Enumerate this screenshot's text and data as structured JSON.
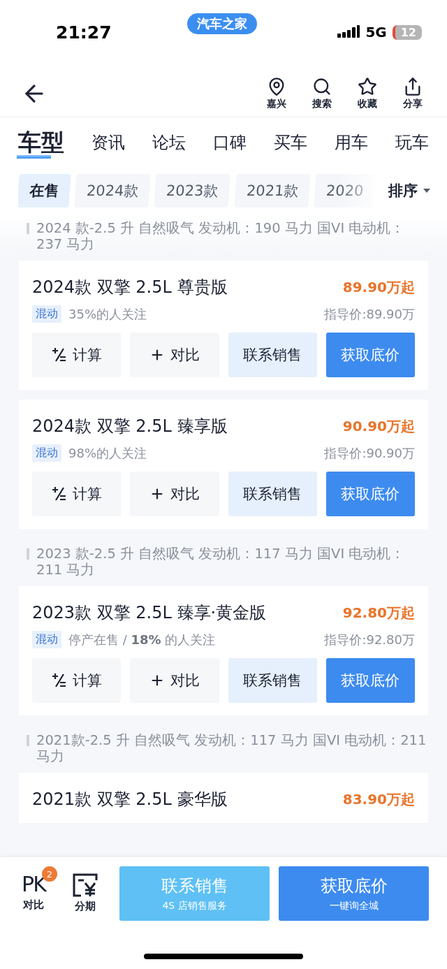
{
  "status_bar": {
    "time": "21:27",
    "app_pill": "汽车之家",
    "network": "5G",
    "battery": "12"
  },
  "header": {
    "actions": [
      {
        "kind": "location",
        "label": "嘉兴"
      },
      {
        "kind": "search",
        "label": "搜索"
      },
      {
        "kind": "favorite",
        "label": "收藏"
      },
      {
        "kind": "share",
        "label": "分享"
      }
    ]
  },
  "nav_tabs": [
    {
      "label": "车型",
      "selected": true
    },
    {
      "label": "资讯",
      "selected": false
    },
    {
      "label": "论坛",
      "selected": false
    },
    {
      "label": "口碑",
      "selected": false
    },
    {
      "label": "买车",
      "selected": false
    },
    {
      "label": "用车",
      "selected": false
    },
    {
      "label": "玩车",
      "selected": false
    }
  ],
  "filters": [
    {
      "label": "在售",
      "selected": true
    },
    {
      "label": "2024款",
      "selected": false
    },
    {
      "label": "2023款",
      "selected": false
    },
    {
      "label": "2021款",
      "selected": false
    },
    {
      "label": "2020",
      "selected": false
    }
  ],
  "sort": {
    "label": "排序"
  },
  "sections": [
    {
      "heading": "2024 款-2.5 升 自然吸气 发动机：190 马力 国VI 电动机：237 马力",
      "models": [
        {
          "title": "2024款 双擎 2.5L 尊贵版",
          "price": "89.90万起",
          "tag": "混动",
          "attention": "35%的人关注",
          "guide_price": "指导价:89.90万",
          "buttons": [
            {
              "kind": "calc",
              "label": "计算"
            },
            {
              "kind": "compare",
              "label": "对比"
            },
            {
              "kind": "contact",
              "label": "联系销售"
            },
            {
              "kind": "price",
              "label": "获取底价"
            }
          ]
        },
        {
          "title": "2024款 双擎 2.5L 臻享版",
          "price": "90.90万起",
          "tag": "混动",
          "attention": "98%的人关注",
          "guide_price": "指导价:90.90万",
          "buttons": [
            {
              "kind": "calc",
              "label": "计算"
            },
            {
              "kind": "compare",
              "label": "对比"
            },
            {
              "kind": "contact",
              "label": "联系销售"
            },
            {
              "kind": "price",
              "label": "获取底价"
            }
          ]
        }
      ]
    },
    {
      "heading": "2023 款-2.5 升 自然吸气 发动机：117 马力 国VI 电动机：211 马力",
      "models": [
        {
          "title": "2023款 双擎 2.5L 臻享·黄金版",
          "price": "92.80万起",
          "tag": "混动",
          "attention": "停产在售 / **18%** 的人关注",
          "guide_price": "指导价:92.80万",
          "buttons": [
            {
              "kind": "calc",
              "label": "计算"
            },
            {
              "kind": "compare",
              "label": "对比"
            },
            {
              "kind": "contact",
              "label": "联系销售"
            },
            {
              "kind": "price",
              "label": "获取底价"
            }
          ]
        }
      ]
    },
    {
      "heading": "2021款-2.5 升 自然吸气 发动机：117 马力 国VI 电动机：211 马力",
      "models": [
        {
          "title": "2021款 双擎 2.5L 豪华版",
          "price": "83.90万起"
        }
      ]
    }
  ],
  "bottom_bar": {
    "pk": {
      "icon_text": "PK",
      "badge": "2",
      "label": "对比"
    },
    "installment": {
      "label": "分期"
    },
    "buttons": [
      {
        "kind": "contact",
        "label": "联系销售",
        "sub": "4S 店销售服务"
      },
      {
        "kind": "price",
        "label": "获取底价",
        "sub": "一键询全城"
      }
    ]
  }
}
